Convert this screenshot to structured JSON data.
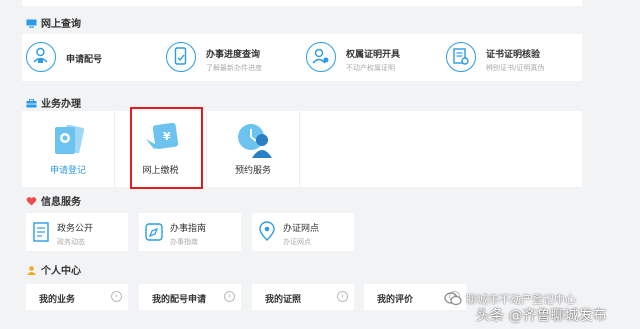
{
  "sections": {
    "online_query": "网上查询",
    "business": "业务办理",
    "info": "信息服务",
    "personal": "个人中心"
  },
  "query_items": [
    {
      "title": "申请配号",
      "sub": "",
      "icon": "user-badge-icon"
    },
    {
      "title": "办事进度查询",
      "sub": "了解最新办件进度",
      "icon": "phone-progress-icon"
    },
    {
      "title": "权属证明开具",
      "sub": "不动产权属证明",
      "icon": "person-certificate-icon"
    },
    {
      "title": "证书证明核验",
      "sub": "辨别证书/证明真伪",
      "icon": "certificate-verify-icon"
    }
  ],
  "business_tiles": [
    {
      "label": "申请登记",
      "icon": "registration-cards-icon"
    },
    {
      "label": "网上缴税",
      "icon": "tax-ticket-icon"
    },
    {
      "label": "预约服务",
      "icon": "appointment-person-icon"
    }
  ],
  "info_items": [
    {
      "title": "政务公开",
      "sub": "政务动态",
      "icon": "document-icon"
    },
    {
      "title": "办事指南",
      "sub": "办事指南",
      "icon": "compass-icon"
    },
    {
      "title": "办证网点",
      "sub": "办证网点",
      "icon": "location-pin-icon"
    }
  ],
  "personal_items": [
    "我的业务",
    "我的配号申请",
    "我的证照",
    "我的评价"
  ],
  "watermark": {
    "faded": "聊城市不动产登记中心",
    "caption": "头条 @齐鲁聊城发布"
  },
  "colors": {
    "accent": "#2b9be8",
    "highlight": "#e01e1e",
    "tile_icon_bg": "#6cc3ef"
  }
}
